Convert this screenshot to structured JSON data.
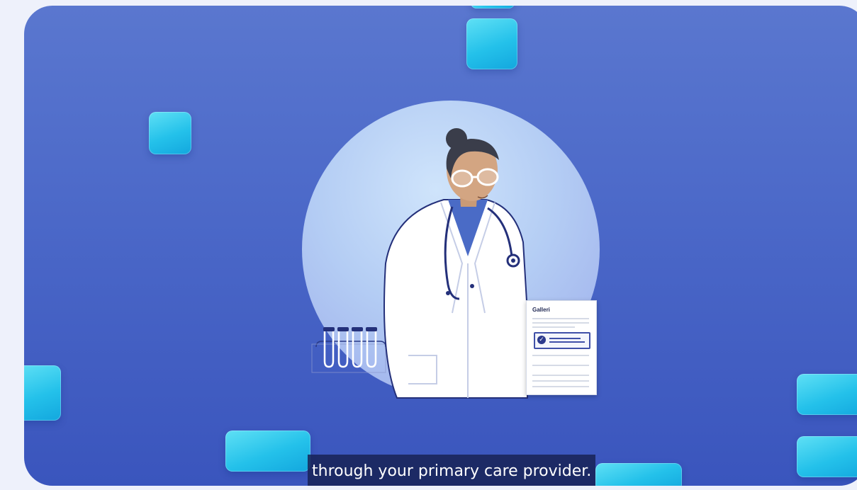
{
  "video": {
    "subtitle": "through your primary care provider.",
    "report_brand": "Galleri"
  },
  "colors": {
    "background_blue": "#4b68c8",
    "tile_cyan": "#24c1ea",
    "circle_light": "#b4cdf4",
    "subtitle_bg": "#182256"
  }
}
